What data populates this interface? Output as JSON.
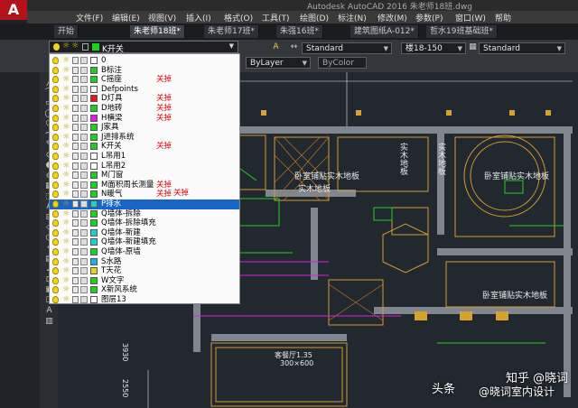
{
  "app": {
    "logo": "A",
    "title": "Autodesk AutoCAD 2016   朱老师18班.dwg"
  },
  "menu": [
    "文件(F)",
    "编辑(E)",
    "视图(V)",
    "插入(I)",
    "格式(O)",
    "工具(T)",
    "绘图(D)",
    "标注(N)",
    "修改(M)",
    "参数(P)",
    "窗口(W)",
    "帮助"
  ],
  "tabs": [
    {
      "label": "开始",
      "active": false
    },
    {
      "label": "朱老师18班*",
      "active": true
    },
    {
      "label": "朱老师17班*",
      "active": false
    },
    {
      "label": "朱强16班*",
      "active": false
    },
    {
      "label": "建筑图纸A-012*",
      "active": false
    },
    {
      "label": "哲水19班基础班*",
      "active": false
    }
  ],
  "toolbar": {
    "layer_current": "K开关",
    "linetype": "ByLayer",
    "color": "ByColor",
    "text_style": "Standard",
    "dim_value": "楼18-150",
    "table_style": "Standard"
  },
  "layers": [
    {
      "name": "0",
      "color": "#ffffff",
      "note": ""
    },
    {
      "name": "B标注",
      "color": "#1fd11f",
      "note": ""
    },
    {
      "name": "C摇座",
      "color": "#1fd11f",
      "note": "关掉"
    },
    {
      "name": "Defpoints",
      "color": "#ffffff",
      "note": ""
    },
    {
      "name": "D灯具",
      "color": "#e11b1b",
      "note": "关掉"
    },
    {
      "name": "D地砖",
      "color": "#1fd11f",
      "note": "关掉"
    },
    {
      "name": "H横梁",
      "color": "#e11be1",
      "note": "关掉"
    },
    {
      "name": "J家具",
      "color": "#1fd11f",
      "note": ""
    },
    {
      "name": "J进排系统",
      "color": "#1fd11f",
      "note": ""
    },
    {
      "name": "K开关",
      "color": "#1fd11f",
      "note": "关掉"
    },
    {
      "name": "L吊用1",
      "color": "#ffffff",
      "note": ""
    },
    {
      "name": "L吊用2",
      "color": "#ffffff",
      "note": ""
    },
    {
      "name": "M门窗",
      "color": "#1fd11f",
      "note": ""
    },
    {
      "name": "M面积周长测量",
      "color": "#1fd11f",
      "note": "关掉"
    },
    {
      "name": "N暖气",
      "color": "#1fd11f",
      "note": "关掉"
    },
    {
      "name": "P排水",
      "color": "#1bd1d1",
      "note": ""
    },
    {
      "name": "Q墙体-拆除",
      "color": "#1fd11f",
      "note": ""
    },
    {
      "name": "Q墙体-拆除填充",
      "color": "#1fd11f",
      "note": ""
    },
    {
      "name": "Q墙体-新建",
      "color": "#1bd1d1",
      "note": ""
    },
    {
      "name": "Q墙体-新建填充",
      "color": "#1bd1d1",
      "note": ""
    },
    {
      "name": "Q墙体-原墙",
      "color": "#1fd11f",
      "note": ""
    },
    {
      "name": "S水路",
      "color": "#1bb1e1",
      "note": ""
    },
    {
      "name": "T天花",
      "color": "#e6d21b",
      "note": ""
    },
    {
      "name": "W文字",
      "color": "#1fd11f",
      "note": ""
    },
    {
      "name": "X新风系统",
      "color": "#1fd11f",
      "note": ""
    },
    {
      "name": "图层13",
      "color": "#ffffff",
      "note": ""
    }
  ],
  "selected_layer_index": 15,
  "side_note": "关掉",
  "cad_labels": {
    "room1": "卧室铺贴实木地板",
    "room2": "卧室铺贴实木地板",
    "room3": "卧室铺贴实木地板",
    "room4": "实木地板",
    "vlabel1": "实木地板",
    "vlabel2": "实木地板",
    "small1": "客餐厅1.35",
    "small2": "300×600",
    "dim1": "3930",
    "dim2": "2550"
  },
  "watermark": {
    "brand": "头条",
    "platform": "知乎 @晓词",
    "author": "@晓词室内设计"
  }
}
